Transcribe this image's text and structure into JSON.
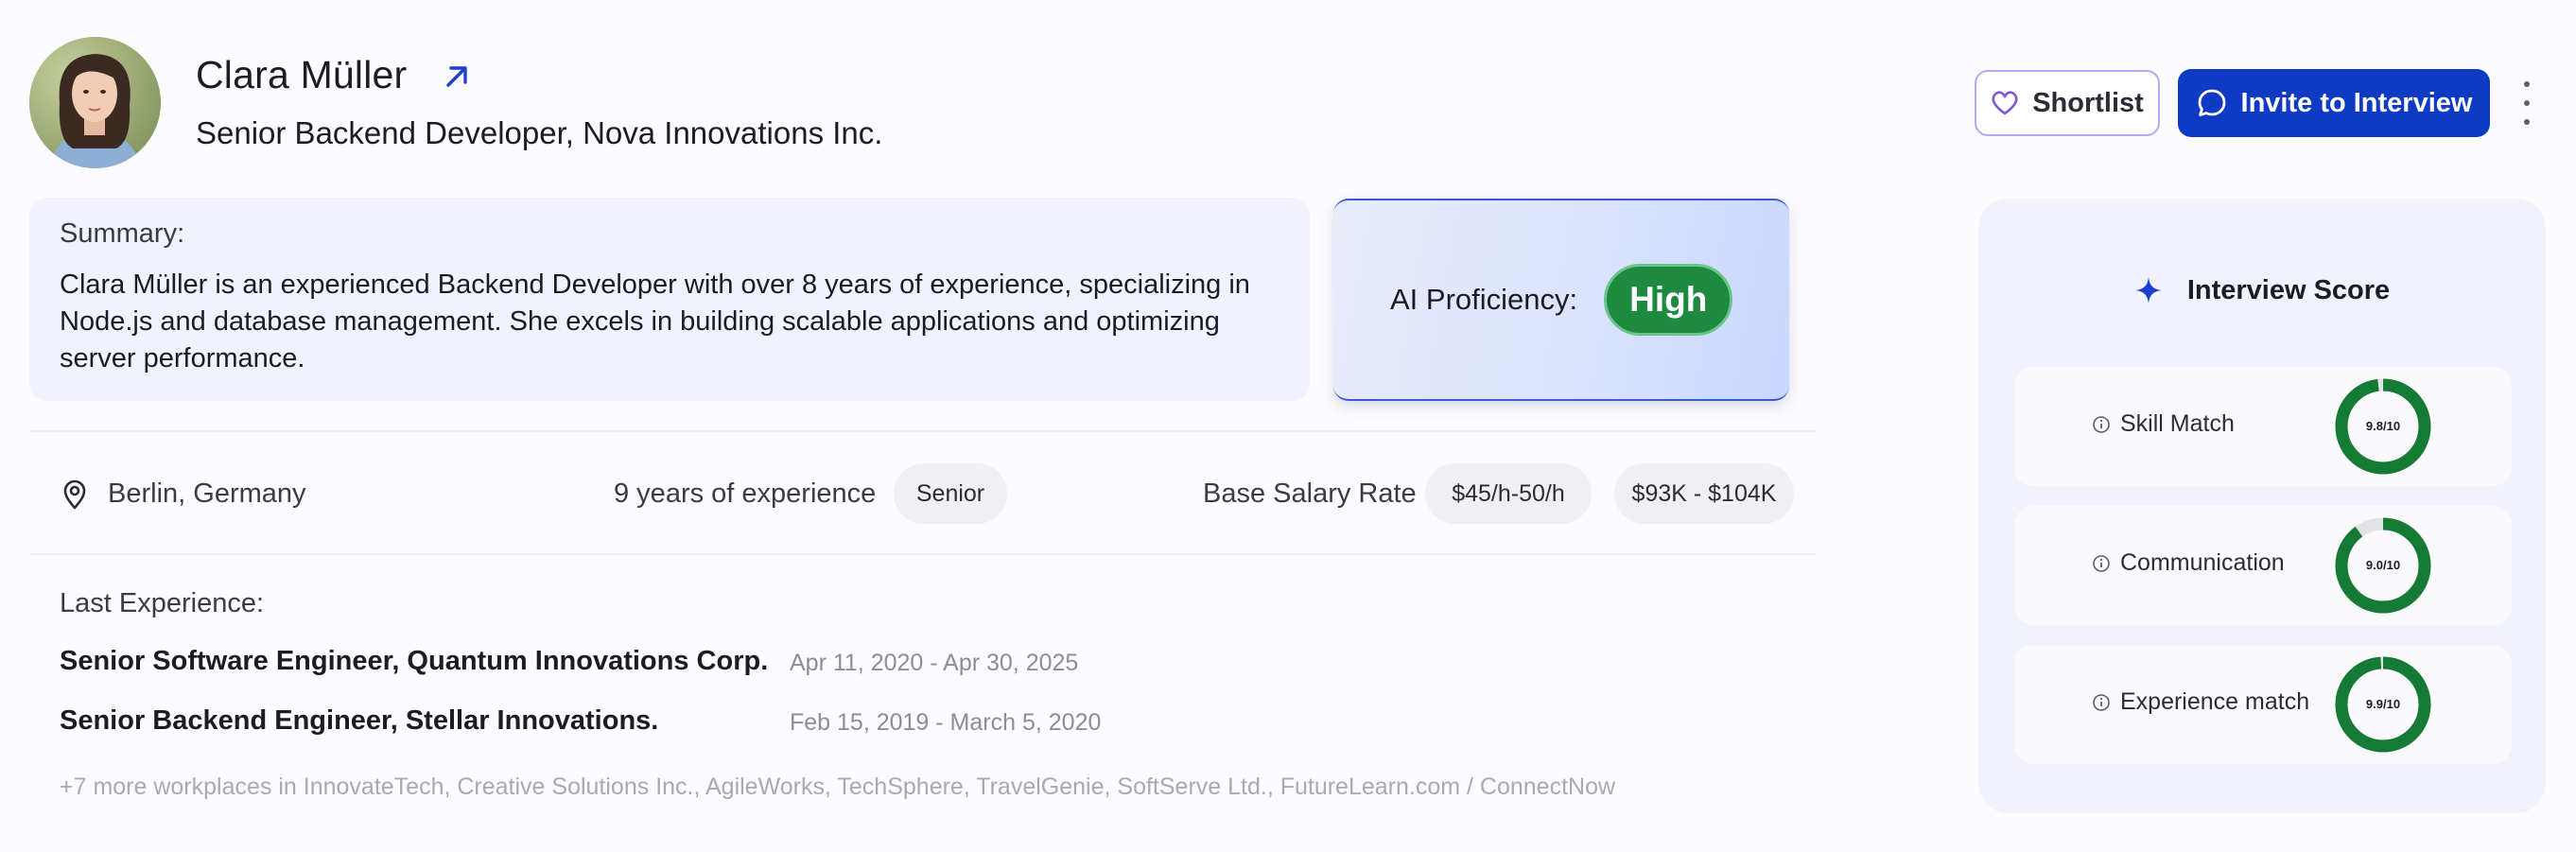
{
  "candidate": {
    "name": "Clara Müller",
    "role": "Senior Backend Developer, Nova Innovations Inc."
  },
  "actions": {
    "shortlist_label": "Shortlist",
    "invite_label": "Invite to Interview"
  },
  "summary": {
    "label": "Summary:",
    "text": "Clara Müller is an experienced Backend Developer with over 8 years of experience, specializing in Node.js and database management. She excels in building scalable applications and optimizing server performance."
  },
  "ai_proficiency": {
    "label": "AI Proficiency:",
    "value": "High",
    "badge_color": "#1d8a3f"
  },
  "info": {
    "location": "Berlin, Germany",
    "experience": "9 years of experience",
    "seniority": "Senior",
    "salary_label": "Base Salary Rate",
    "hourly": "$45/h-50/h",
    "annual": "$93K - $104K"
  },
  "experience": {
    "label": "Last Experience:",
    "items": [
      {
        "title": "Senior Software Engineer, Quantum Innovations Corp.",
        "dates": "Apr 11, 2020 - Apr 30, 2025"
      },
      {
        "title": "Senior Backend Engineer, Stellar Innovations.",
        "dates": "Feb 15, 2019 - March 5, 2020"
      }
    ],
    "more": "+7 more workplaces in InnovateTech, Creative Solutions Inc., AgileWorks, TechSphere, TravelGenie, SoftServe Ltd., FutureLearn.com / ConnectNow"
  },
  "interview_score": {
    "title": "Interview Score",
    "ring_color": "#157a33",
    "ring_track": "#e2e3e6",
    "items": [
      {
        "label": "Skill Match",
        "score": 9.8,
        "display": "9.8/10"
      },
      {
        "label": "Communication",
        "score": 9.0,
        "display": "9.0/10"
      },
      {
        "label": "Experience match",
        "score": 9.9,
        "display": "9.9/10"
      }
    ]
  },
  "colors": {
    "primary": "#0f3bc4",
    "shortlist_border": "#b9a7ee"
  }
}
